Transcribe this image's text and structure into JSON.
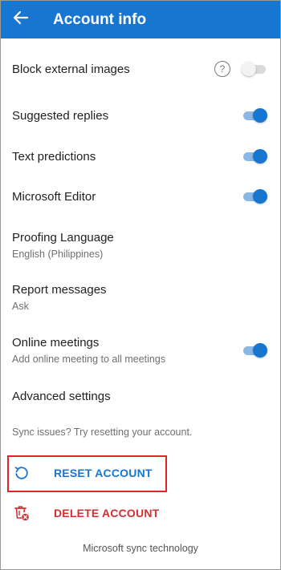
{
  "appbar": {
    "title": "Account info",
    "background_color": "#1676d2",
    "back_icon": "arrow-left-icon"
  },
  "settings": [
    {
      "id": "block-external-images",
      "label": "Block external images",
      "toggle": false,
      "help_icon": true
    },
    {
      "id": "suggested-replies",
      "label": "Suggested replies",
      "toggle": true
    },
    {
      "id": "text-predictions",
      "label": "Text predictions",
      "toggle": true
    },
    {
      "id": "microsoft-editor",
      "label": "Microsoft Editor",
      "toggle": true
    },
    {
      "id": "proofing-language",
      "label": "Proofing Language",
      "value": "English (Philippines)"
    },
    {
      "id": "report-messages",
      "label": "Report messages",
      "value": "Ask"
    },
    {
      "id": "online-meetings",
      "label": "Online meetings",
      "value": "Add online meeting to all meetings",
      "toggle": true
    },
    {
      "id": "advanced-settings",
      "label": "Advanced settings"
    }
  ],
  "sync_hint": "Sync issues? Try resetting your account.",
  "actions": {
    "reset": {
      "label": "RESET ACCOUNT",
      "color": "#1676d2",
      "icon": "reset-icon"
    },
    "delete": {
      "label": "DELETE ACCOUNT",
      "color": "#d32f2f",
      "icon": "delete-account-icon"
    }
  },
  "highlight_color": "#e0232b",
  "footer": "Microsoft sync technology"
}
